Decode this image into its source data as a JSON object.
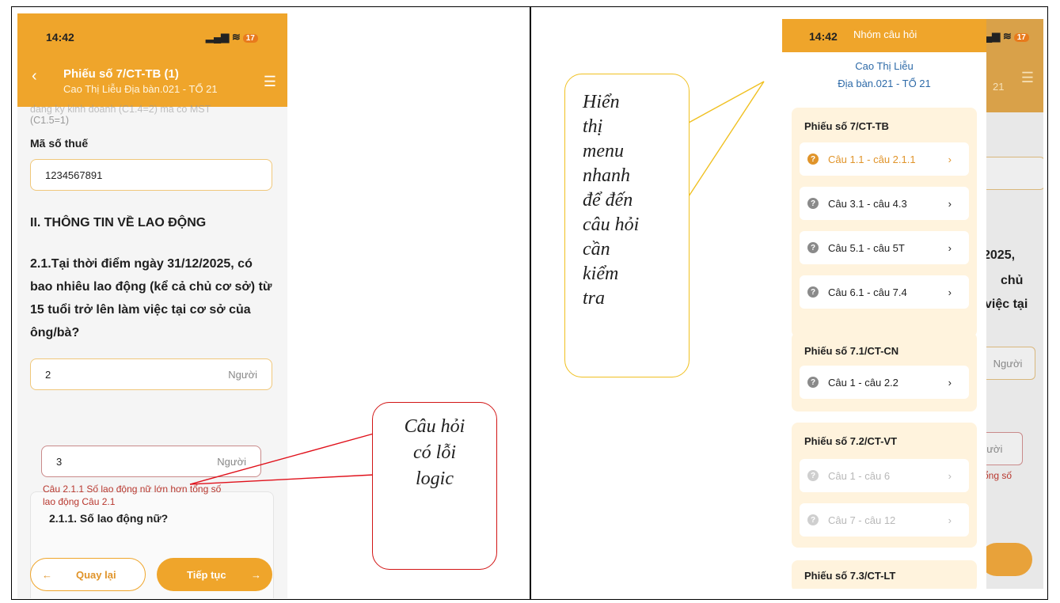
{
  "left": {
    "status_time": "14:42",
    "battery": "17",
    "title": "Phiếu số 7/CT-TB (1)",
    "subtitle": "Cao Thị Liễu Địa bàn.021 - TỔ 21",
    "faded_top_line1": "dang ky kinh doanh (C1.4=2) ma co MST",
    "faded_top_line2": "(C1.5=1)",
    "tax_label": "Mã số thuế",
    "tax_value": "1234567891",
    "section_title": "II. THÔNG TIN VỀ LAO ĐỘNG",
    "question_21": "2.1.Tại thời điểm ngày 31/12/2025, có bao nhiêu lao động (kể cả chủ cơ sở) từ 15 tuổi trở lên làm việc tại cơ sở của ông/bà?",
    "q21_value": "2",
    "unit": "Người",
    "question_211": "2.1.1. Số lao động nữ?",
    "q211_value": "3",
    "error_line1": "Câu 2.1.1 Số lao động nữ lớn hơn tổng số",
    "error_line2": "lao động Câu 2.1",
    "back_button": "Quay lại",
    "next_button": "Tiếp tục"
  },
  "callout_left": {
    "lines": [
      "Câu hỏi",
      "có lỗi",
      "logic"
    ]
  },
  "callout_right": {
    "lines": [
      "Hiển",
      "thị",
      "menu",
      "nhanh",
      "để đến",
      "câu hỏi",
      "cần",
      "kiểm",
      "tra"
    ]
  },
  "right": {
    "status_time": "14:42",
    "drawer_title": "Nhóm câu hỏi",
    "battery": "17",
    "person_name": "Cao Thị Liễu",
    "area": "Địa bàn.021 - TỔ 21",
    "bg_fragments": {
      "year": "2025,",
      "owner": "chủ",
      "work": "việc tại",
      "unit1": "Người",
      "unit2": "gười",
      "tong": "ổng số",
      "num": "21"
    },
    "groups": [
      {
        "title": "Phiếu số 7/CT-TB",
        "items": [
          "Câu 1.1 - câu 2.1.1",
          "Câu 3.1 - câu 4.3",
          "Câu 5.1 - câu 5T",
          "Câu 6.1 - câu 7.4"
        ]
      },
      {
        "title": "Phiếu số 7.1/CT-CN",
        "items": [
          "Câu 1 - câu 2.2"
        ]
      },
      {
        "title": "Phiếu số 7.2/CT-VT",
        "items": [
          "Câu 1 - câu 6",
          "Câu 7 - câu 12"
        ]
      },
      {
        "title": "Phiếu số 7.3/CT-LT",
        "items": []
      }
    ]
  }
}
